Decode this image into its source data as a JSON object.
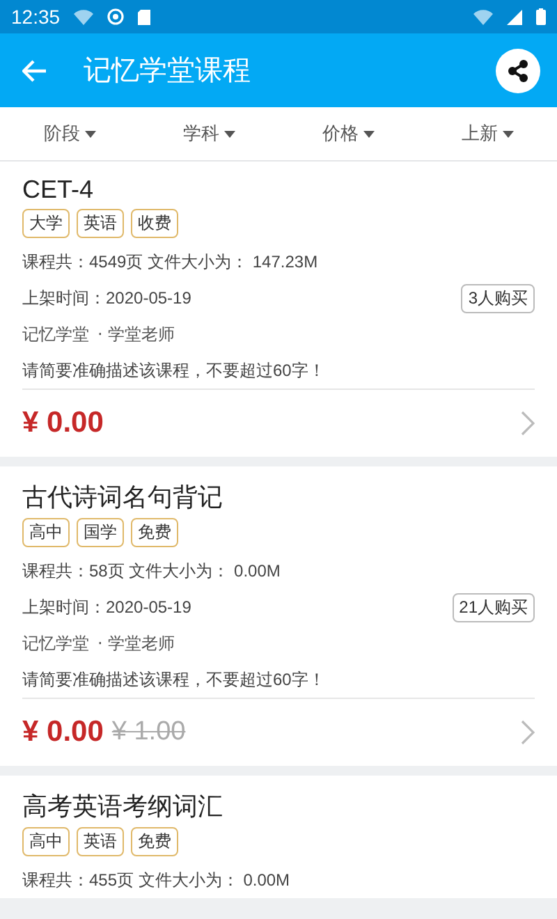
{
  "status_bar": {
    "time": "12:35"
  },
  "app_bar": {
    "title": "记忆学堂课程"
  },
  "filters": [
    {
      "label": "阶段"
    },
    {
      "label": "学科"
    },
    {
      "label": "价格"
    },
    {
      "label": "上新"
    }
  ],
  "courses": [
    {
      "title": "CET-4",
      "tags": [
        "大学",
        "英语",
        "收费"
      ],
      "info": "课程共：4549页  文件大小为：  147.23M",
      "date": "上架时间：2020-05-19",
      "buyers": "3人购买",
      "publisher": "记忆学堂",
      "teacher": "· 学堂老师",
      "description": "请简要准确描述该课程，不要超过60字！",
      "price": "¥ 0.00"
    },
    {
      "title": "古代诗词名句背记",
      "tags": [
        "高中",
        "国学",
        "免费"
      ],
      "info": "课程共：58页  文件大小为：  0.00M",
      "date": "上架时间：2020-05-19",
      "buyers": "21人购买",
      "publisher": "记忆学堂",
      "teacher": "· 学堂老师",
      "description": "请简要准确描述该课程，不要超过60字！",
      "price": "¥ 0.00",
      "original_price": "¥ 1.00"
    },
    {
      "title": "高考英语考纲词汇",
      "tags": [
        "高中",
        "英语",
        "免费"
      ],
      "info": "课程共：455页  文件大小为：  0.00M"
    }
  ]
}
